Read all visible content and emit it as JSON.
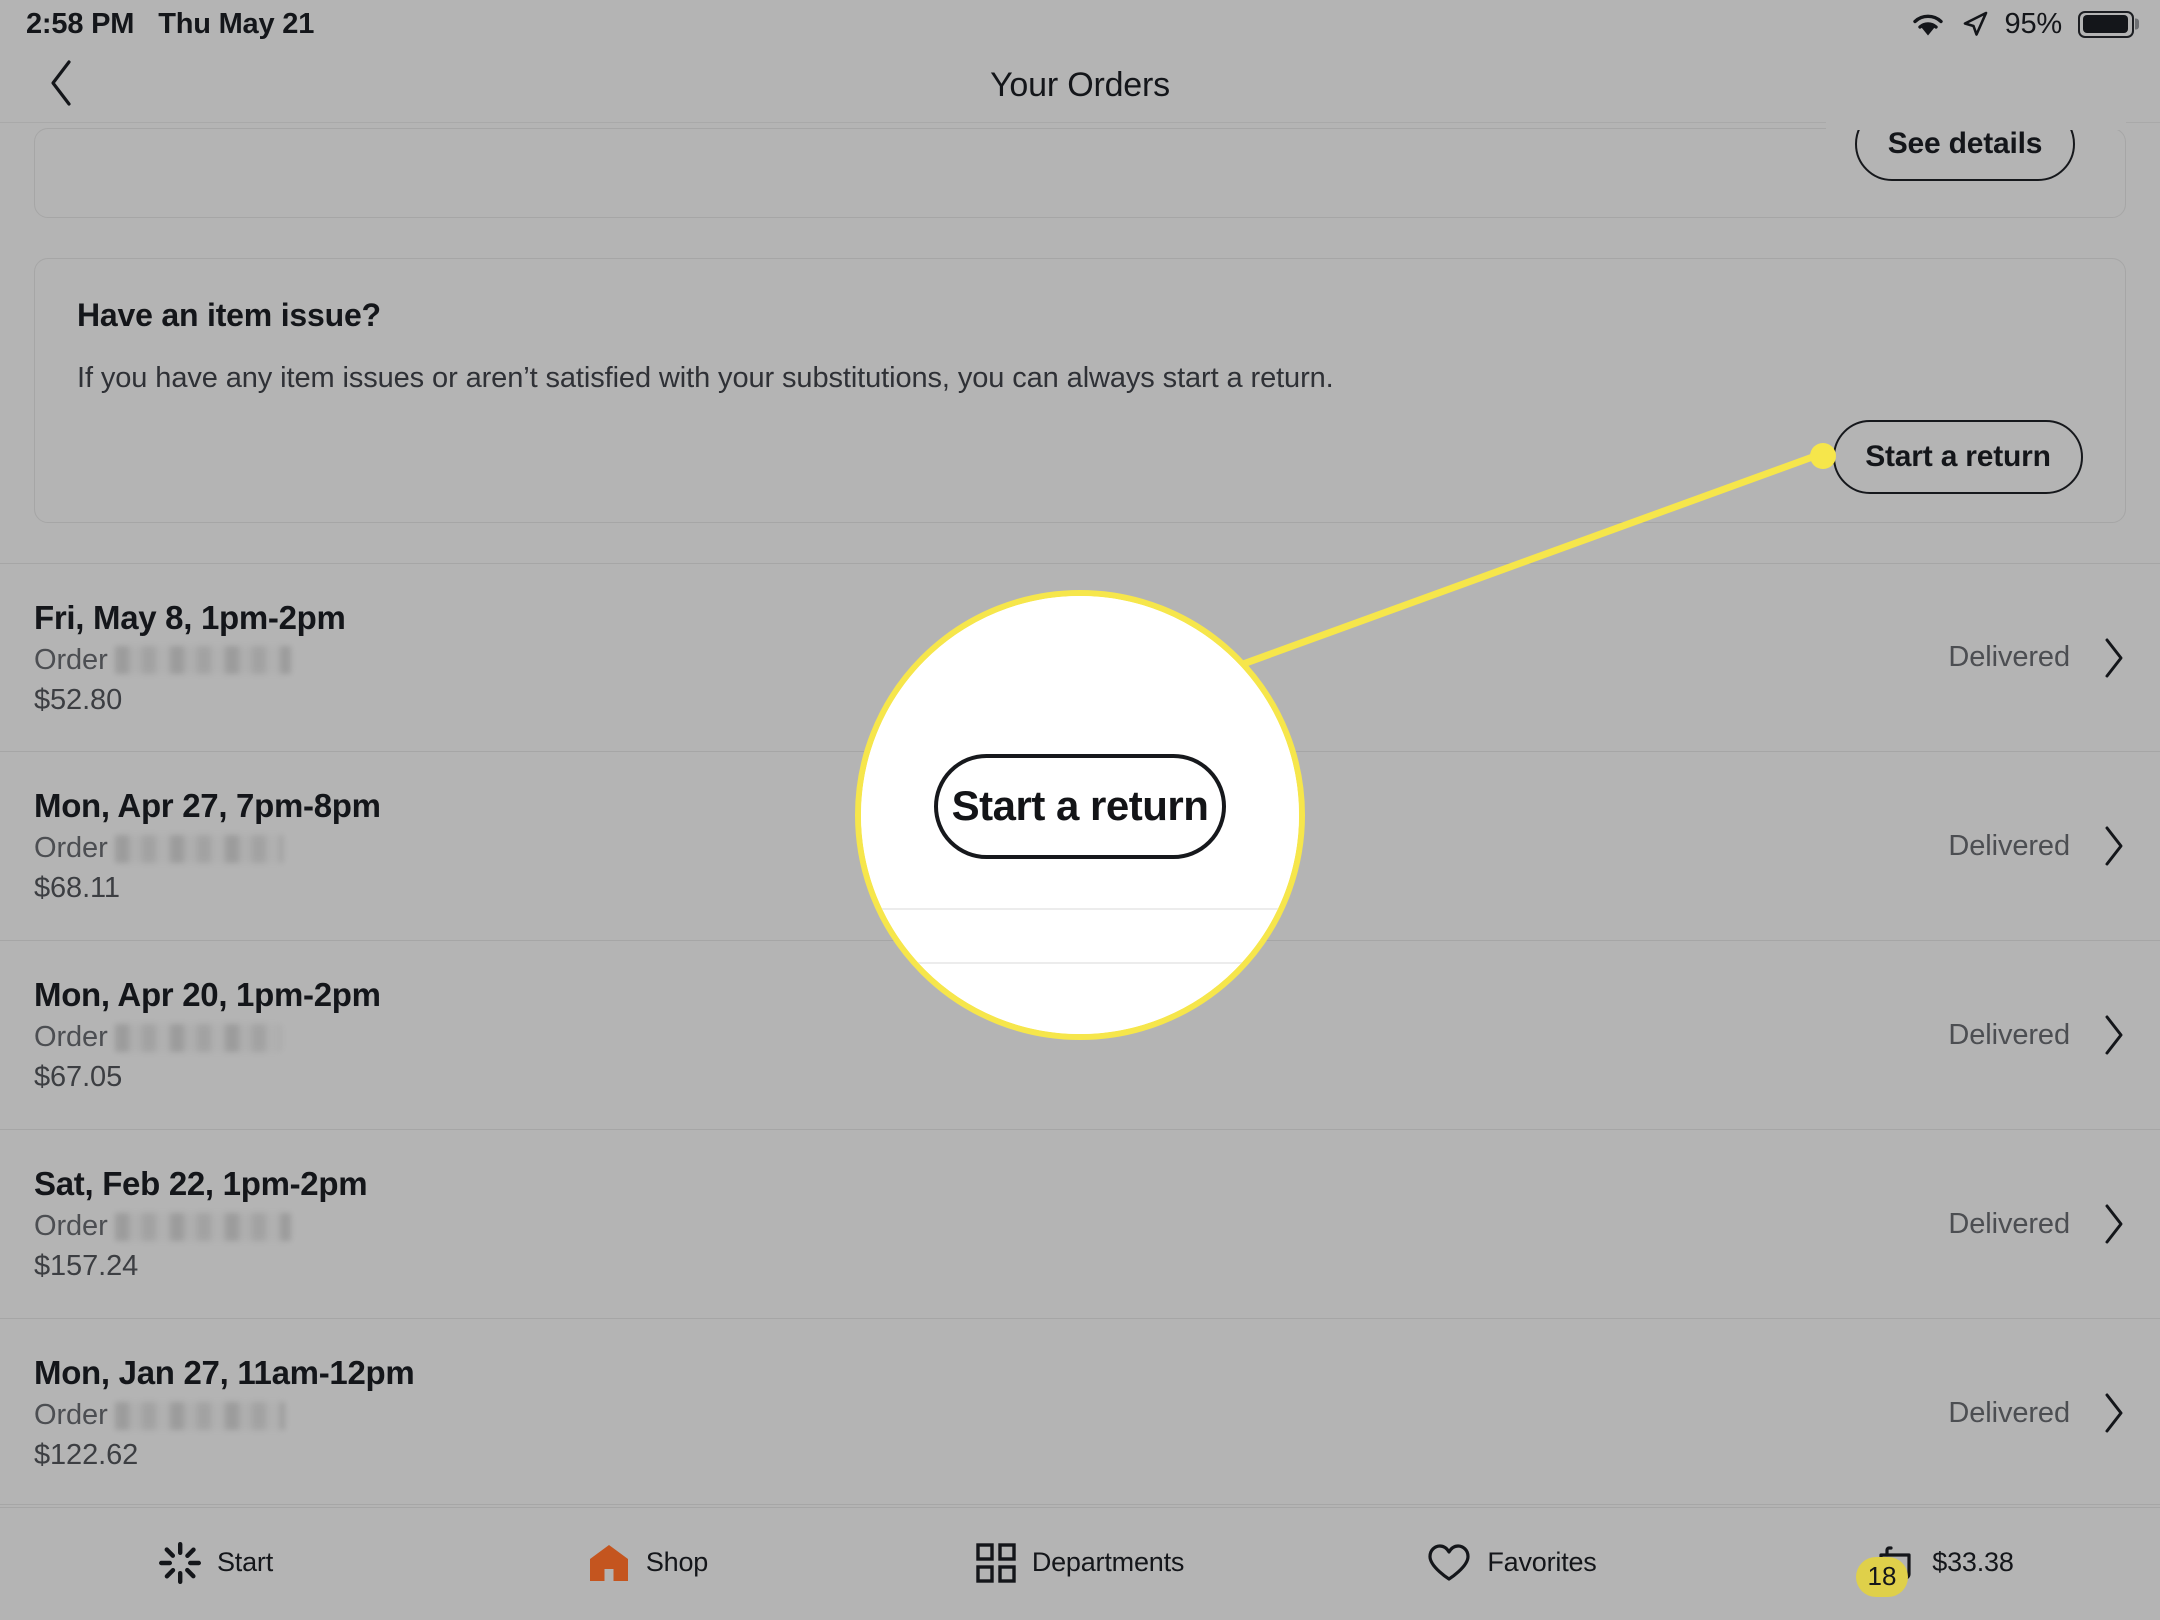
{
  "status_bar": {
    "time": "2:58 PM",
    "date": "Thu May 21",
    "battery_percent": "95%",
    "wifi_icon": "wifi-icon",
    "location_icon": "location-arrow-icon",
    "battery_icon": "battery-icon"
  },
  "header": {
    "title": "Your Orders",
    "back_icon": "chevron-left-icon"
  },
  "order_summary_card": {
    "see_details_label": "See details"
  },
  "item_issue_card": {
    "title": "Have an item issue?",
    "description": "If you have any item issues or aren’t satisfied with your substitutions, you can always start a return.",
    "start_return_label": "Start a return"
  },
  "callout": {
    "magnified_button_label": "Start a return",
    "highlight_color": "#f6e64b",
    "dot_color": "#f6e64b"
  },
  "orders": [
    {
      "date": "Fri, May 8, 1pm-2pm",
      "order_prefix": "Order",
      "order_number": "",
      "total": "$52.80",
      "status": "Delivered",
      "chevron_icon": "chevron-right-icon"
    },
    {
      "date": "Mon, Apr 27, 7pm-8pm",
      "order_prefix": "Order",
      "order_number": "",
      "total": "$68.11",
      "status": "Delivered",
      "chevron_icon": "chevron-right-icon"
    },
    {
      "date": "Mon, Apr 20, 1pm-2pm",
      "order_prefix": "Order",
      "order_number": "",
      "total": "$67.05",
      "status": "Delivered",
      "chevron_icon": "chevron-right-icon"
    },
    {
      "date": "Sat, Feb 22, 1pm-2pm",
      "order_prefix": "Order",
      "order_number": "",
      "total": "$157.24",
      "status": "Delivered",
      "chevron_icon": "chevron-right-icon"
    },
    {
      "date": "Mon, Jan 27, 11am-12pm",
      "order_prefix": "Order",
      "order_number": "",
      "total": "$122.62",
      "status": "Delivered",
      "chevron_icon": "chevron-right-icon"
    }
  ],
  "bottom_nav": {
    "items": [
      {
        "label": "Start",
        "icon": "walmart-spark-icon"
      },
      {
        "label": "Shop",
        "icon": "store-house-icon"
      },
      {
        "label": "Departments",
        "icon": "grid-icon"
      },
      {
        "label": "Favorites",
        "icon": "heart-icon"
      },
      {
        "label": "$33.38",
        "icon": "cart-icon",
        "badge": "18"
      }
    ]
  }
}
